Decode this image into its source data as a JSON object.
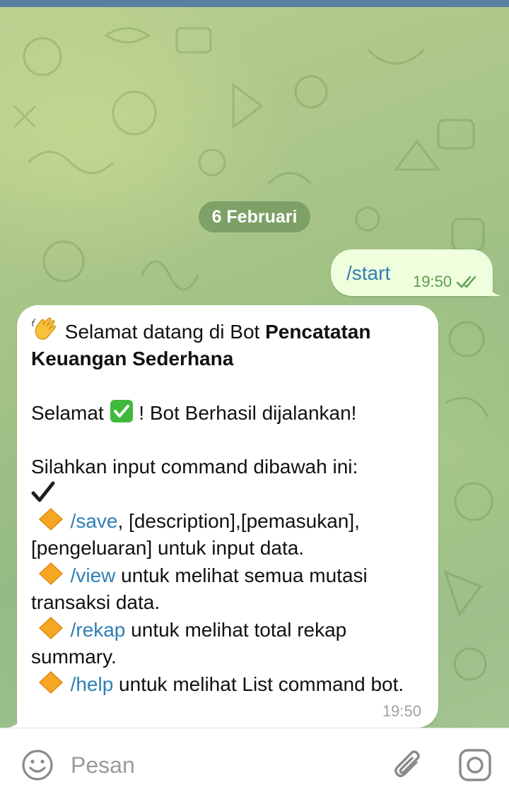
{
  "chat": {
    "date_separator": "6 Februari",
    "outgoing": {
      "text": "/start",
      "time": "19:50",
      "status": "double-check-read"
    },
    "incoming": {
      "time": "19:50",
      "greeting_emoji": "waving-hand-icon",
      "greeting_text": " Selamat datang di Bot ",
      "bot_name": "Pencatatan Keuangan Sederhana",
      "success_prefix": "Selamat ",
      "success_emoji": "check-mark-button-icon",
      "success_suffix": " ! Bot Berhasil dijalankan!",
      "instruction": "Silahkan input command dibawah ini:",
      "instruction_emoji": "heavy-check-mark-icon",
      "commands": [
        {
          "command": "/save",
          "description": ", [description],[pemasukan],[pengeluaran] untuk input data."
        },
        {
          "command": "/view",
          "description": " untuk melihat semua mutasi transaksi data."
        },
        {
          "command": "/rekap",
          "description": " untuk melihat total rekap summary."
        },
        {
          "command": "/help",
          "description": " untuk melihat List command bot."
        }
      ],
      "bullet_emoji": "orange-diamond-icon"
    }
  },
  "input_bar": {
    "placeholder": "Pesan",
    "icons": [
      "smile-icon",
      "paperclip-icon",
      "camera-icon"
    ]
  },
  "colors": {
    "link": "#2f7fb6",
    "outgoing_bubble": "#effedd",
    "incoming_bubble": "#ffffff",
    "date_pill": "#70965c",
    "top_bar": "#5a7fa3"
  }
}
